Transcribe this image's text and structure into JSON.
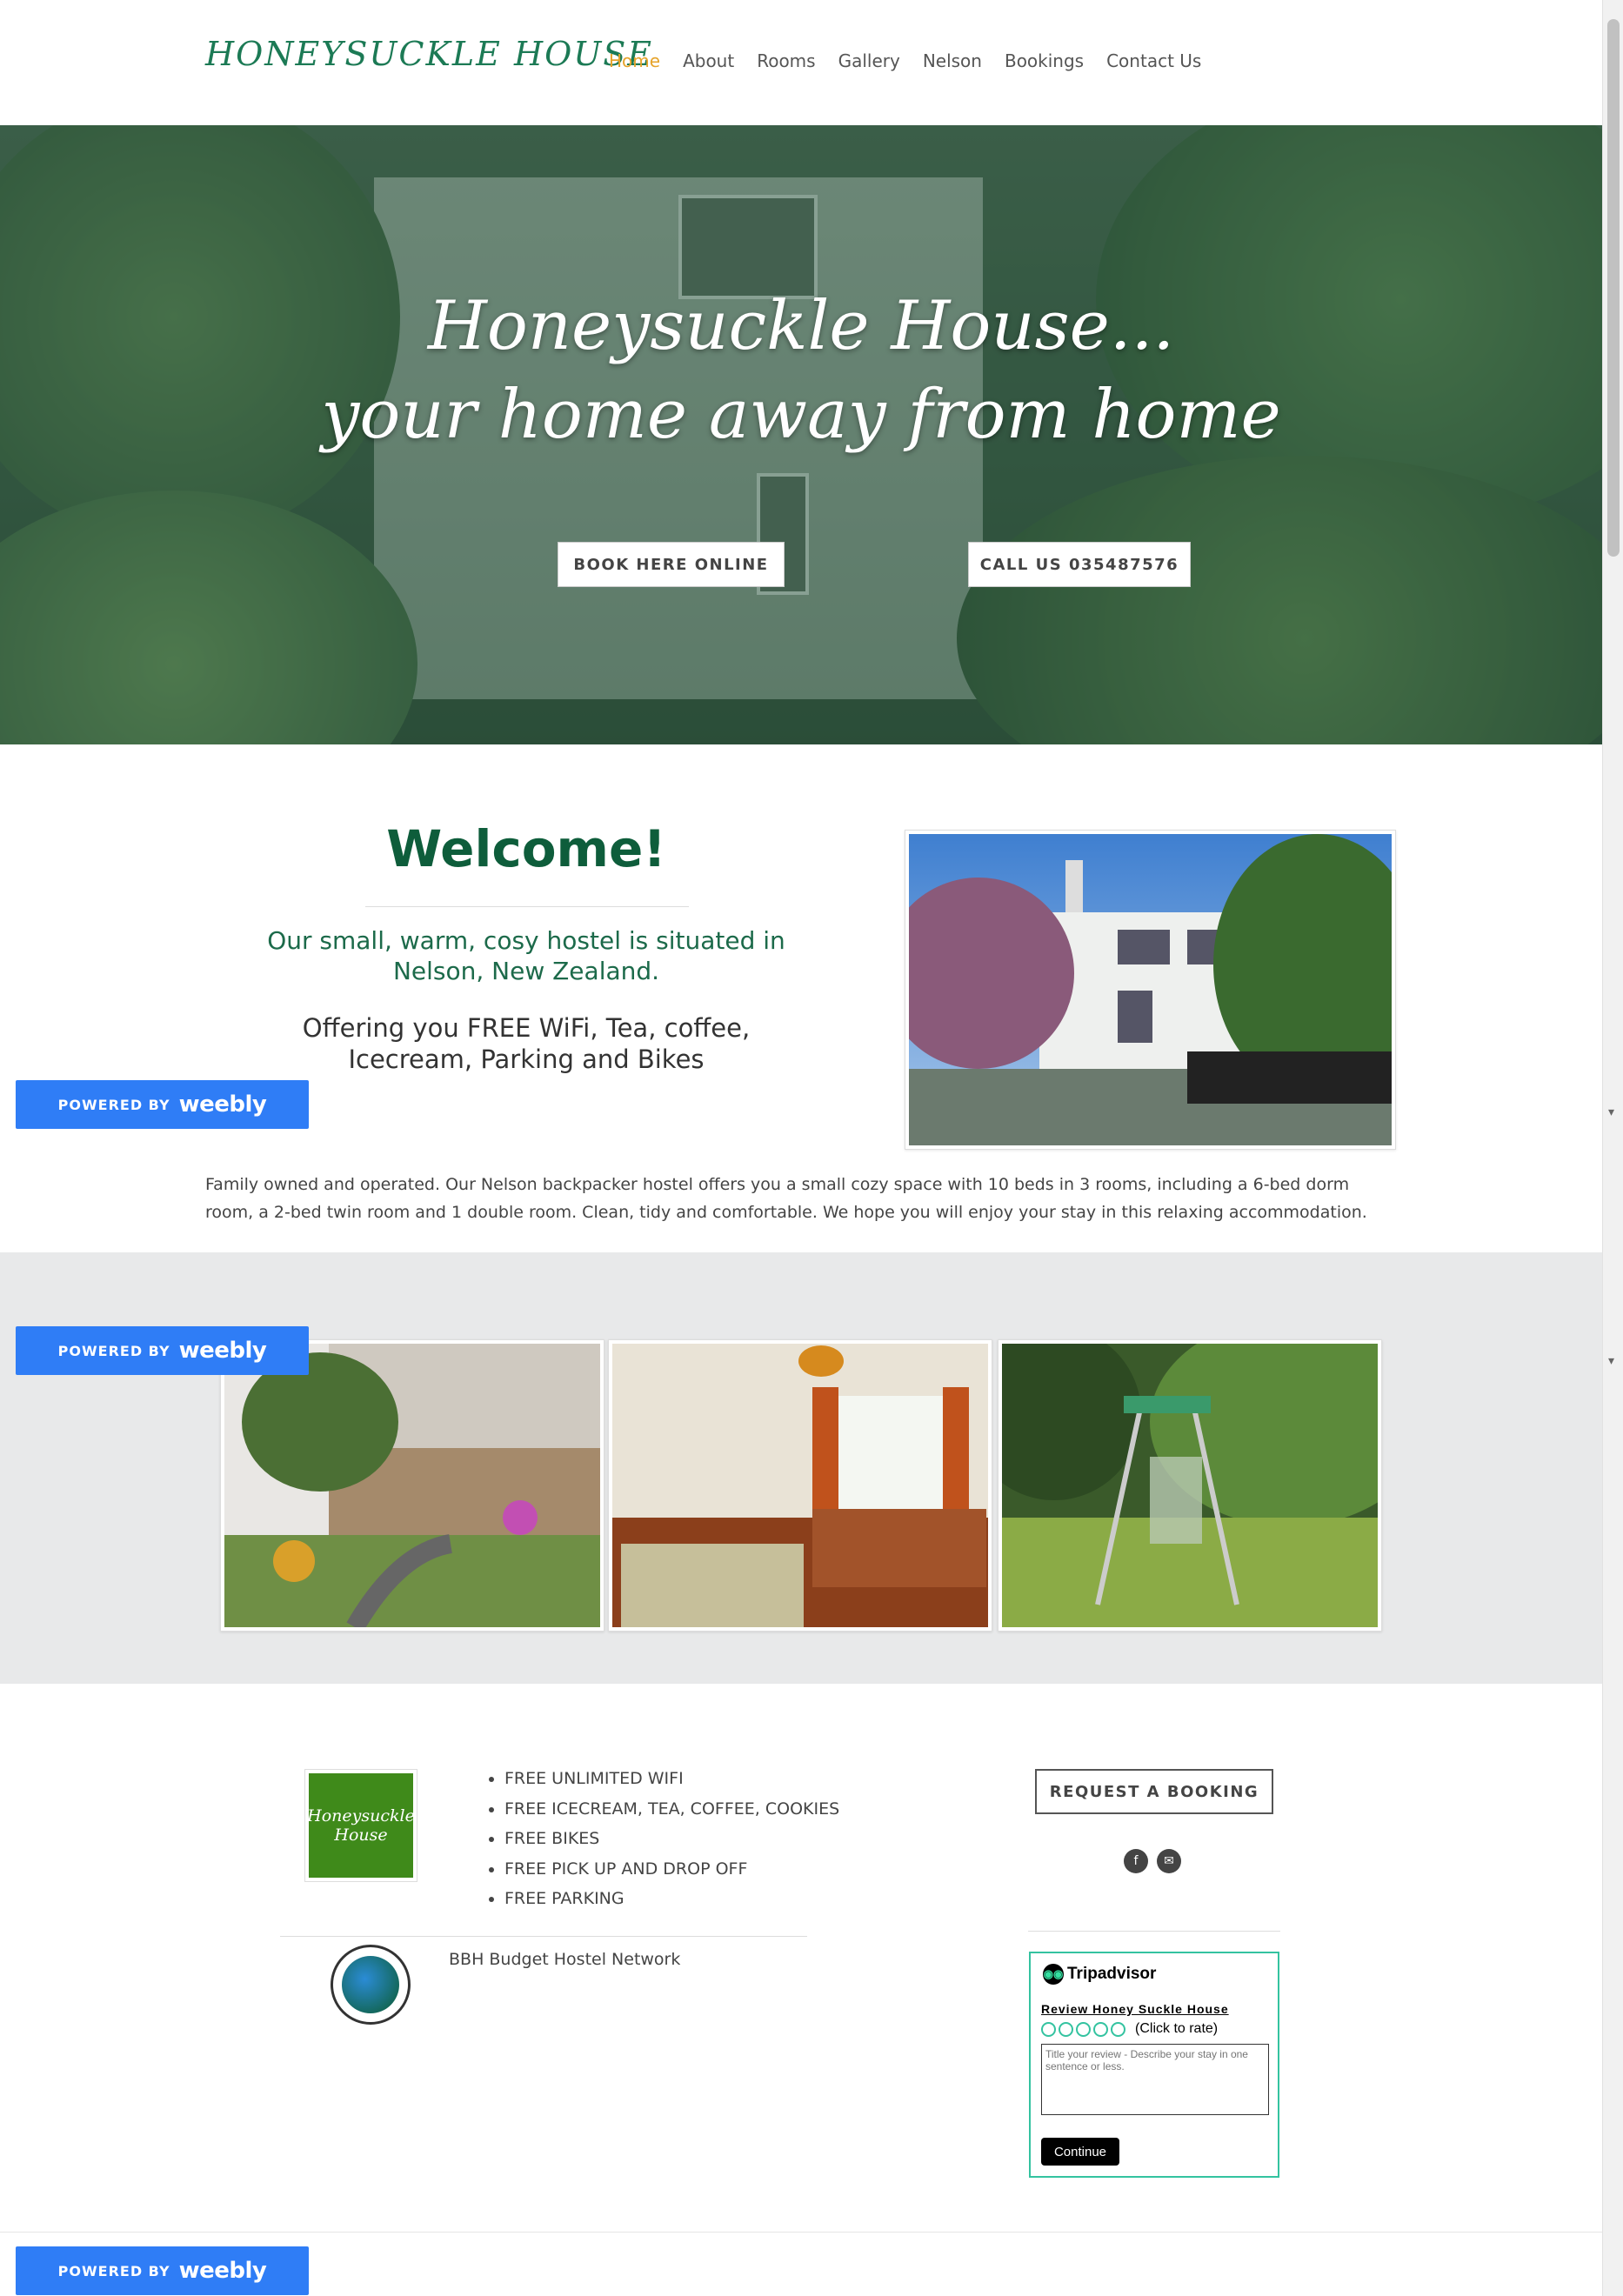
{
  "header": {
    "logo": "HONEYSUCKLE HOUSE",
    "nav": [
      "Home",
      "About",
      "Rooms",
      "Gallery",
      "Nelson",
      "Bookings",
      "Contact Us"
    ],
    "active": "Home"
  },
  "hero": {
    "line1": "Honeysuckle House...",
    "line2": "your home away from home",
    "book_btn": "BOOK HERE ONLINE",
    "call_btn": "CALL US 035487576"
  },
  "welcome": {
    "title": "Welcome!",
    "subtitle": "Our small, warm, cosy hostel is situated in Nelson, New Zealand.",
    "offering": "Offering you FREE WiFi, Tea, coffee, Icecream, Parking and Bikes",
    "body": "Family owned and operated. Our Nelson backpacker hostel offers you a small cozy space with 10 beds in 3 rooms, including a 6-bed dorm room, a 2-bed twin room and 1 double room. Clean, tidy and comfortable. We hope you will enjoy your stay in this relaxing accommodation."
  },
  "features": {
    "logo_text": "Honeysuckle House",
    "list": [
      "FREE UNLIMITED WIFI",
      "FREE ICECREAM, TEA, COFFEE, COOKIES",
      "FREE BIKES",
      "FREE PICK UP AND DROP OFF",
      "FREE PARKING"
    ],
    "bbh": "BBH Budget Hostel Network",
    "request_btn": "REQUEST A BOOKING",
    "social": [
      "f",
      "✉"
    ]
  },
  "tripadvisor": {
    "brand": "Tripadvisor",
    "review_link": "Review Honey Suckle House",
    "click_to_rate": "(Click to rate)",
    "placeholder": "Title your review - Describe your stay in one sentence or less.",
    "continue": "Continue"
  },
  "weebly": {
    "powered": "POWERED BY",
    "brand": "weebly"
  },
  "colors": {
    "accent": "#e6a32a",
    "logo_green": "#1c7a55",
    "title_green": "#0e5d3b",
    "weebly_blue": "#2f7df6",
    "tripadvisor_green": "#34c3a0"
  }
}
